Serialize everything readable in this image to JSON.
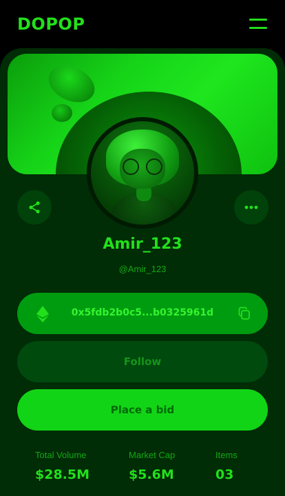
{
  "header": {
    "logo": "DOPOP",
    "menu_icon": "hamburger-icon"
  },
  "profile": {
    "name": "Amir_123",
    "handle": "@Amir_123",
    "share_icon": "share-icon",
    "more_icon": "more-dots-icon"
  },
  "wallet": {
    "currency_icon": "ethereum-icon",
    "address": "0x5fdb2b0c5...b0325961d",
    "copy_icon": "copy-icon"
  },
  "actions": {
    "follow_label": "Follow",
    "bid_label": "Place a bid"
  },
  "stats": [
    {
      "label": "Total Volume",
      "value": "$28.5M"
    },
    {
      "label": "Market Cap",
      "value": "$5.6M"
    },
    {
      "label": "Items",
      "value": "03"
    }
  ],
  "colors": {
    "accent": "#22e01b",
    "background": "#000000",
    "card": "#002c06",
    "button_dark": "#004a0d",
    "button_bright": "#12d416"
  }
}
